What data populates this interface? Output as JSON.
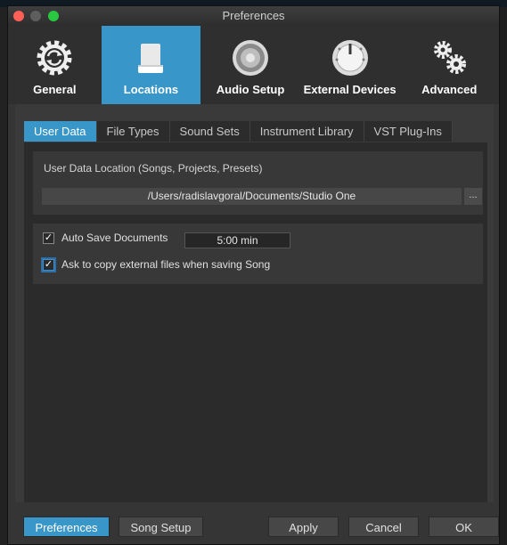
{
  "window": {
    "title": "Preferences"
  },
  "toolbar": {
    "items": [
      {
        "label": "General",
        "icon": "refresh-cog-icon"
      },
      {
        "label": "Locations",
        "icon": "drive-icon",
        "active": true
      },
      {
        "label": "Audio Setup",
        "icon": "speaker-icon"
      },
      {
        "label": "External Devices",
        "icon": "knob-icon"
      },
      {
        "label": "Advanced",
        "icon": "gears-icon"
      }
    ]
  },
  "tabs": [
    {
      "label": "User Data",
      "active": true
    },
    {
      "label": "File Types"
    },
    {
      "label": "Sound Sets"
    },
    {
      "label": "Instrument Library"
    },
    {
      "label": "VST Plug-Ins"
    }
  ],
  "user_data": {
    "location_label": "User Data Location (Songs, Projects, Presets)",
    "path": "/Users/radislavgoral/Documents/Studio One",
    "browse_label": "..."
  },
  "options": {
    "auto_save_label": "Auto Save Documents",
    "auto_save_checked": true,
    "auto_save_interval": "5:00 min",
    "ask_copy_label": "Ask to copy external files when saving Song",
    "ask_copy_checked": true
  },
  "footer": {
    "preferences": "Preferences",
    "song_setup": "Song Setup",
    "apply": "Apply",
    "cancel": "Cancel",
    "ok": "OK"
  },
  "colors": {
    "accent": "#3996c8"
  }
}
